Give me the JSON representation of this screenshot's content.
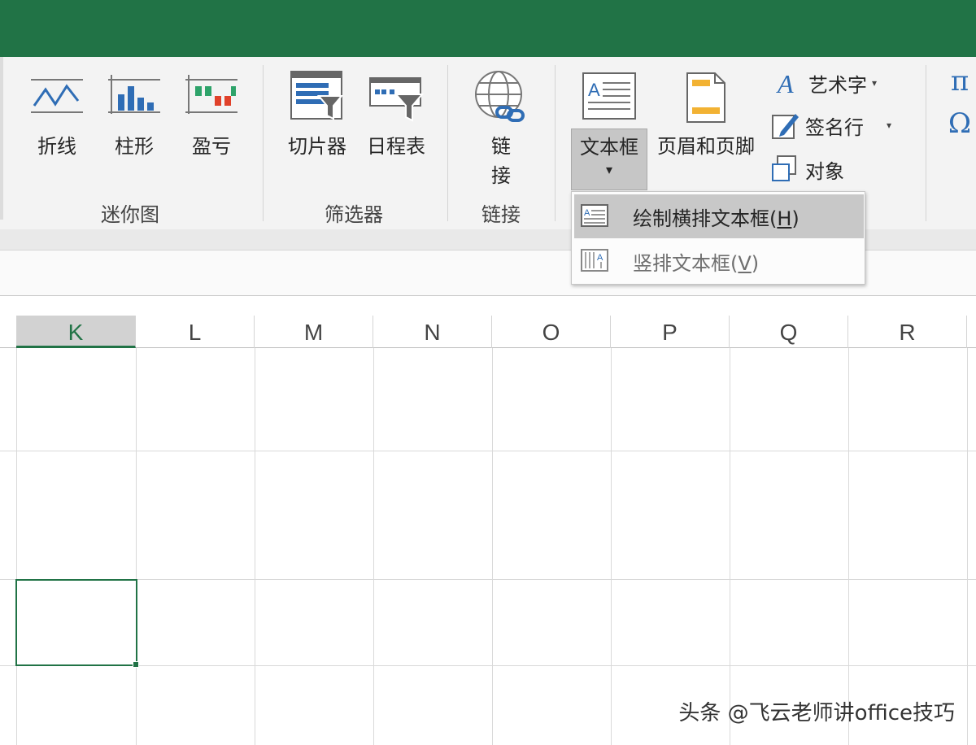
{
  "ribbon": {
    "sparklines": {
      "group_label": "迷你图",
      "line_label": "折线",
      "column_label": "柱形",
      "winloss_label": "盈亏"
    },
    "filters": {
      "group_label": "筛选器",
      "slicer_label": "切片器",
      "timeline_label": "日程表"
    },
    "links": {
      "group_label": "链接",
      "link_label_line1": "链",
      "link_label_line2": "接"
    },
    "text": {
      "textbox_label": "文本框",
      "textbox_caret": "▾",
      "header_footer_label": "页眉和页脚",
      "wordart_label": "艺术字",
      "signature_label": "签名行",
      "object_label": "对象"
    },
    "symbols": {
      "equation_glyph": "π",
      "symbol_glyph": "Ω"
    }
  },
  "textbox_menu": {
    "items": [
      {
        "label": "绘制横排文本框(",
        "accel": "H",
        "suffix": ")"
      },
      {
        "label": "竖排文本框(",
        "accel": "V",
        "suffix": ")"
      }
    ]
  },
  "sheet": {
    "columns": [
      "K",
      "L",
      "M",
      "N",
      "O",
      "P",
      "Q",
      "R"
    ],
    "active_column": "K"
  },
  "watermark": "头条 @飞云老师讲office技巧",
  "colors": {
    "excel_green": "#217346",
    "ribbon_bg": "#f3f3f3",
    "menu_hover": "#c8c8c8"
  }
}
